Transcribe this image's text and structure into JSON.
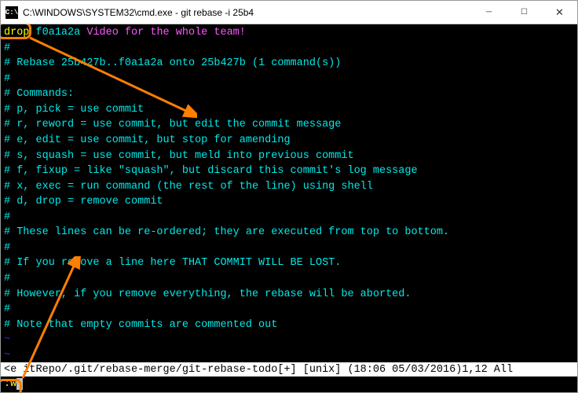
{
  "titlebar": {
    "icon_text": "C:\\",
    "title": "C:\\WINDOWS\\SYSTEM32\\cmd.exe - git  rebase -i 25b4"
  },
  "content": {
    "drop_keyword": "drop",
    "commit_hash": "f0a1a2a",
    "commit_msg": "Video for the whole team!",
    "hash1": "#",
    "rebase_line": "# Rebase 25b427b..f0a1a2a onto 25b427b (1 command(s))",
    "hash2": "#",
    "commands_header": "# Commands:",
    "cmd_p": "# p, pick = use commit",
    "cmd_r": "# r, reword = use commit, but edit the commit message",
    "cmd_e": "# e, edit = use commit, but stop for amending",
    "cmd_s": "# s, squash = use commit, but meld into previous commit",
    "cmd_f": "# f, fixup = like \"squash\", but discard this commit's log message",
    "cmd_x": "# x, exec = run command (the rest of the line) using shell",
    "cmd_d": "# d, drop = remove commit",
    "hash3": "#",
    "note_reorder": "# These lines can be re-ordered; they are executed from top to bottom.",
    "hash4": "#",
    "note_lost": "# If you remove a line here THAT COMMIT WILL BE LOST.",
    "hash5": "#",
    "note_abort": "# However, if you remove everything, the rebase will be aborted.",
    "hash6": "#",
    "note_empty": "# Note that empty commits are commented out",
    "tilde1": "~",
    "tilde2": "~"
  },
  "statusline": "<e itRepo/.git/rebase-merge/git-rebase-todo[+] [unix] (18:06 05/03/2016)1,12 All",
  "cmdline": ":w"
}
